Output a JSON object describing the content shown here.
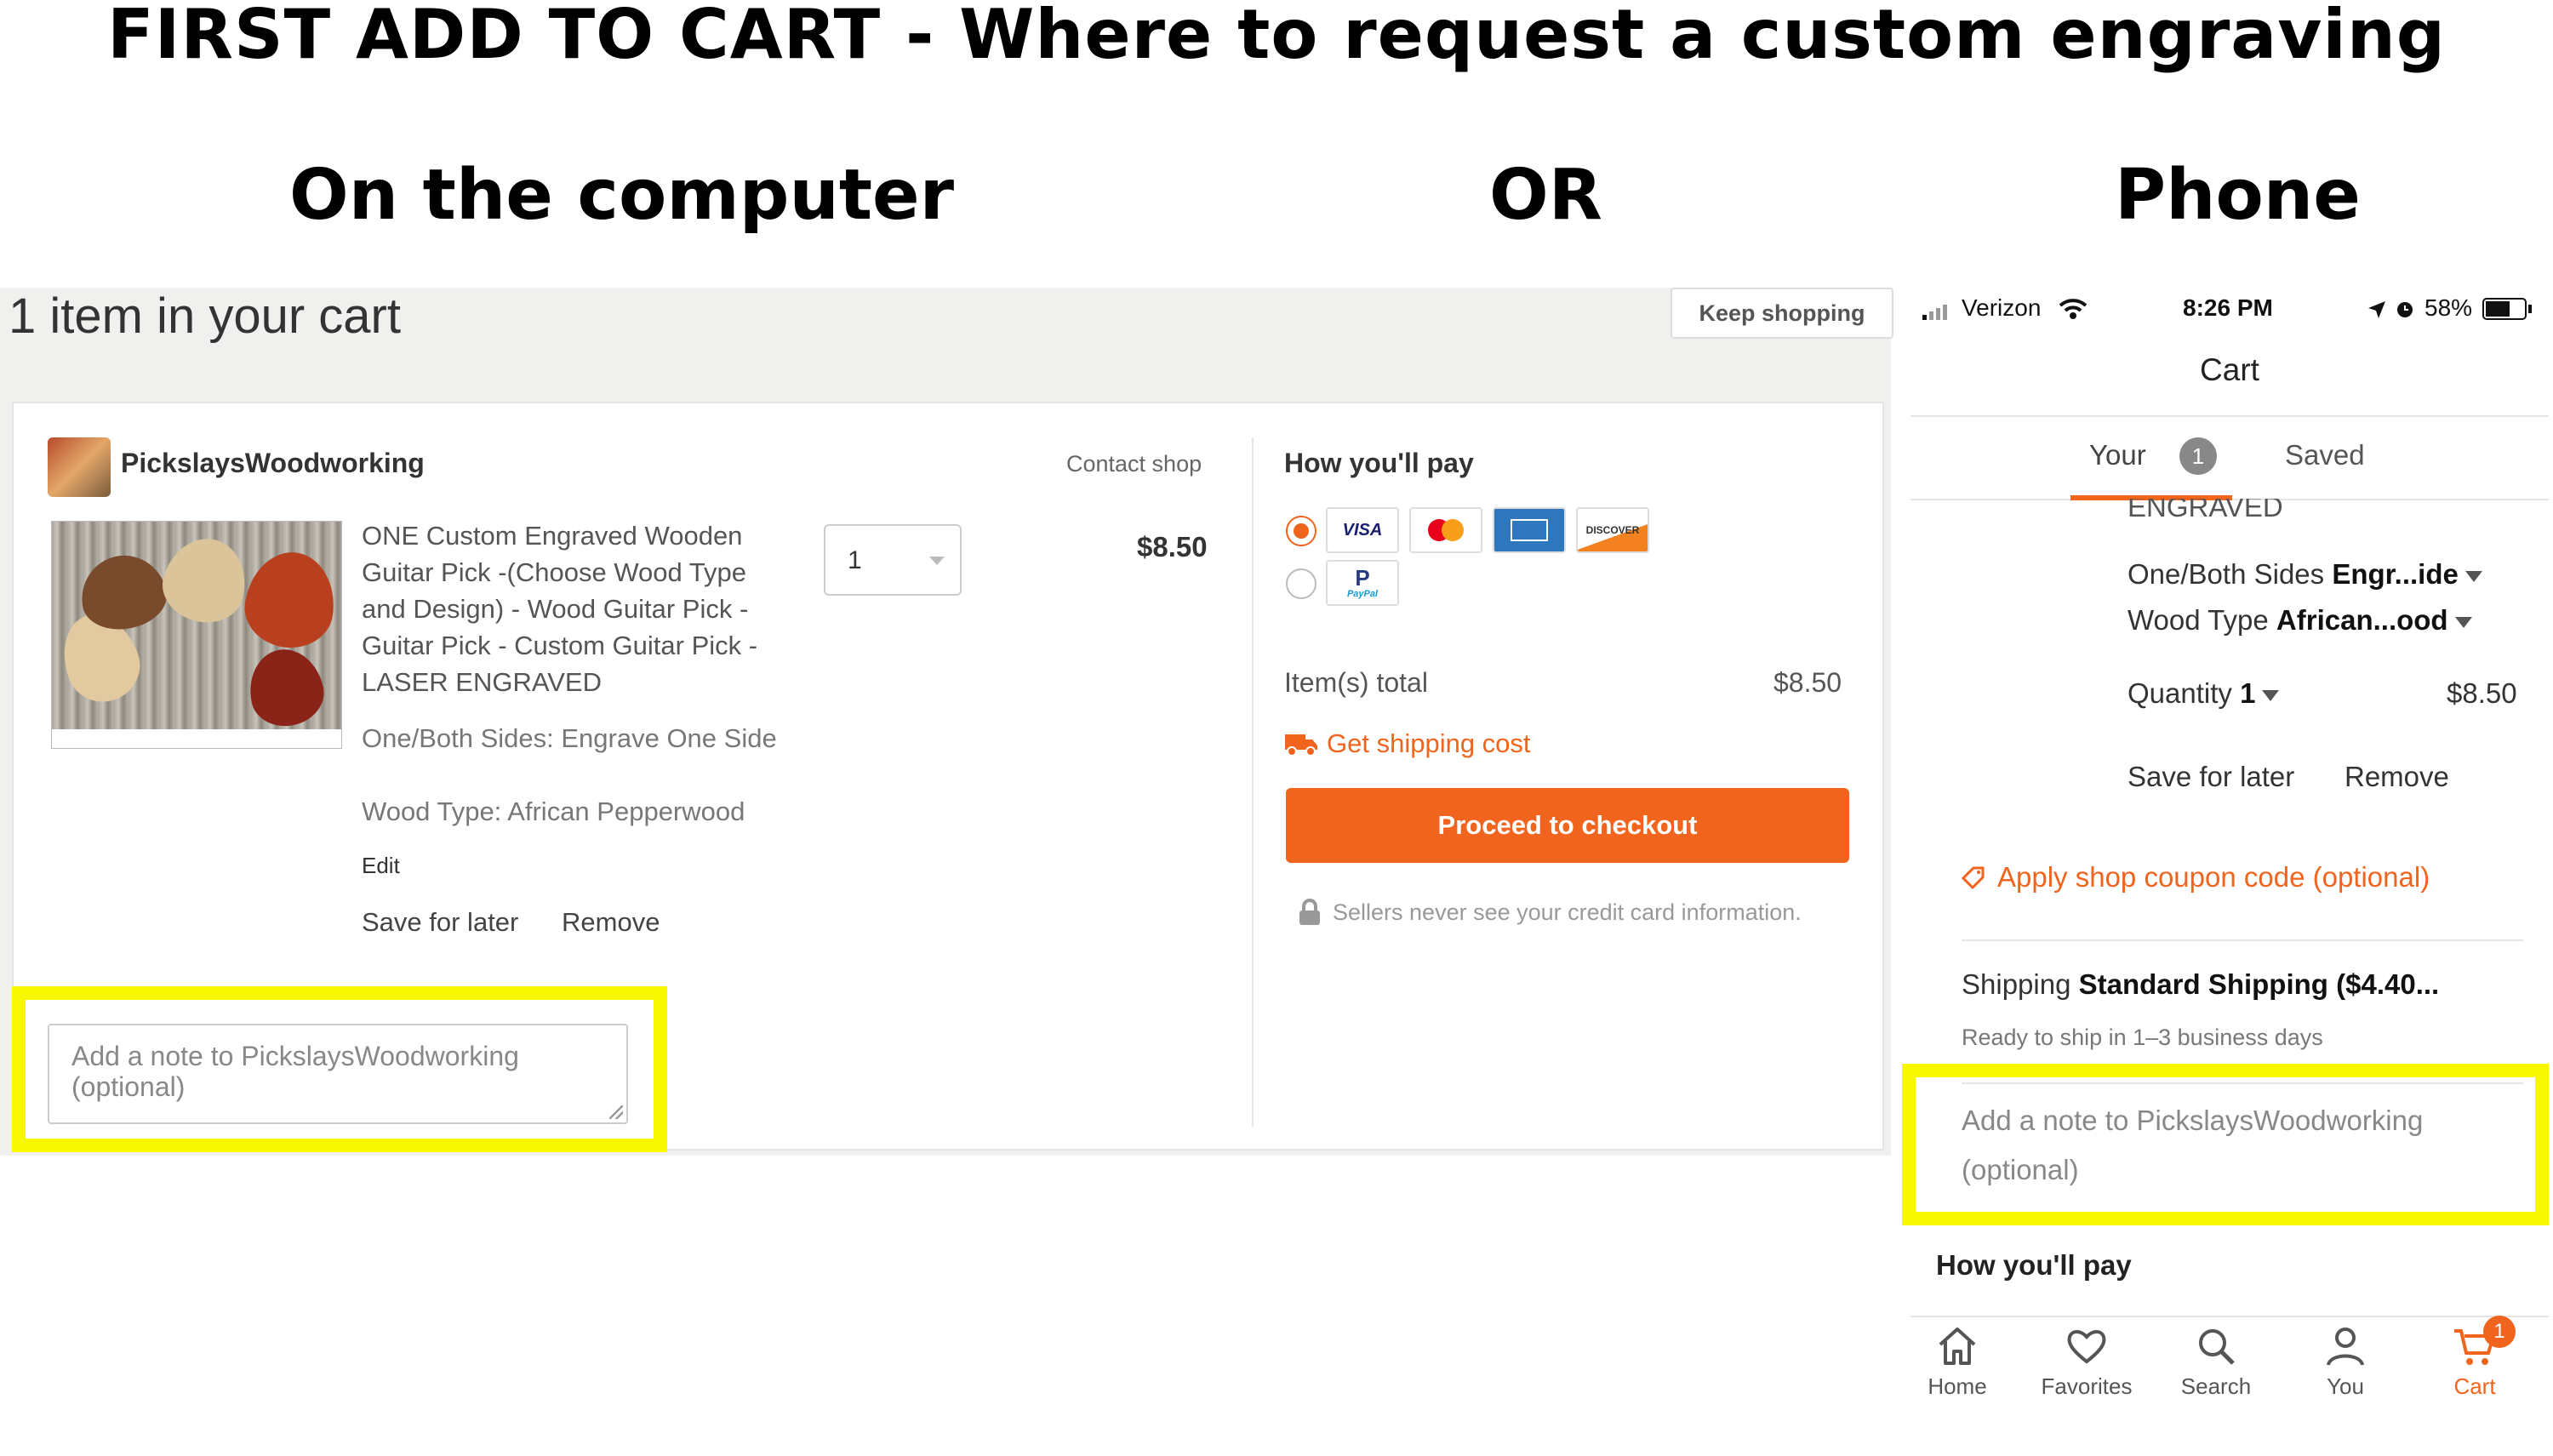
{
  "main_title": "FIRST ADD TO CART - Where to request a custom engraving",
  "labels": {
    "computer": "On the computer",
    "or": "OR",
    "phone": "Phone"
  },
  "desktop": {
    "cart_title": "1 item in your cart",
    "keep_shopping": "Keep shopping",
    "shop_name": "PickslaysWoodworking",
    "contact_shop": "Contact shop",
    "product_title": "ONE Custom Engraved Wooden Guitar Pick -(Choose Wood Type and Design) - Wood Guitar Pick - Guitar Pick - Custom Guitar Pick - LASER ENGRAVED",
    "option_sides": "One/Both Sides: Engrave One Side",
    "option_wood": "Wood Type: African Pepperwood",
    "edit": "Edit",
    "save_for_later": "Save for later",
    "remove": "Remove",
    "quantity": "1",
    "price": "$8.50",
    "how_youll_pay": "How you'll pay",
    "card_icons": [
      "visa-card-icon",
      "mastercard-icon",
      "amex-card-icon",
      "discover-card-icon",
      "paypal-icon"
    ],
    "card_labels": {
      "visa": "VISA",
      "discover": "DISCOVER",
      "paypal": "PayPal"
    },
    "items_total_label": "Item(s) total",
    "items_total_value": "$8.50",
    "shipping_cost": "Get shipping cost",
    "checkout": "Proceed to checkout",
    "secure_note": "Sellers never see your credit card information.",
    "note_placeholder": "Add a note to PickslaysWoodworking (optional)"
  },
  "phone": {
    "carrier": "Verizon",
    "time": "8:26 PM",
    "battery": "58%",
    "title": "Cart",
    "tab_your": "Your",
    "tab_your_count": "1",
    "tab_saved": "Saved",
    "engraved_cut": "ENGRAVED",
    "sides_label": "One/Both Sides",
    "sides_value": "Engr...ide",
    "wood_label": "Wood Type",
    "wood_value": "African...ood",
    "qty_label": "Quantity",
    "qty_value": "1",
    "price": "$8.50",
    "save_for_later": "Save for later",
    "remove": "Remove",
    "coupon": "Apply shop coupon code (optional)",
    "shipping_label": "Shipping",
    "shipping_value": "Standard Shipping ($4.40...",
    "ready": "Ready to ship in 1–3 business days",
    "note_placeholder": "Add a note to PickslaysWoodworking (optional)",
    "how_youll_pay": "How you'll pay",
    "nav": [
      {
        "label": "Home",
        "icon": "home-icon"
      },
      {
        "label": "Favorites",
        "icon": "heart-icon"
      },
      {
        "label": "Search",
        "icon": "search-icon"
      },
      {
        "label": "You",
        "icon": "user-icon"
      },
      {
        "label": "Cart",
        "icon": "cart-icon",
        "badge": "1"
      }
    ]
  },
  "colors": {
    "accent": "#f1641e",
    "highlight": "#f7f700"
  }
}
